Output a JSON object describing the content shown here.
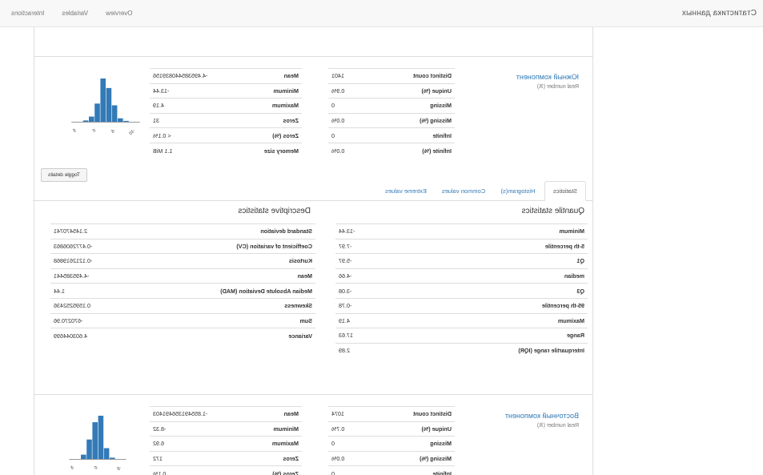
{
  "navbar": {
    "brand": "Статистика данных",
    "links": [
      "Overview",
      "Variables",
      "Interactions"
    ]
  },
  "variables": [
    {
      "name": "Южный компонент",
      "type": "Real number (ℝ)",
      "stats_left": [
        {
          "label": "Distinct count",
          "value": "1401"
        },
        {
          "label": "Unique (%)",
          "value": "0.9%"
        },
        {
          "label": "Missing",
          "value": "0"
        },
        {
          "label": "Missing (%)",
          "value": "0.0%"
        },
        {
          "label": "Infinite",
          "value": "0"
        },
        {
          "label": "Infinite (%)",
          "value": "0.0%"
        }
      ],
      "stats_right": [
        {
          "label": "Mean",
          "value": "-4.495385440839156"
        },
        {
          "label": "Minimum",
          "value": "-13.44"
        },
        {
          "label": "Maximum",
          "value": "4.19"
        },
        {
          "label": "Zeros",
          "value": "31"
        },
        {
          "label": "Zeros (%)",
          "value": "< 0.1%"
        },
        {
          "label": "Memory size",
          "value": "1.1 MiB"
        }
      ],
      "histogram": {
        "ticks": [
          "-10",
          "-5",
          "0",
          "5"
        ],
        "bars": [
          0.02,
          0.08,
          0.38,
          0.78,
          1.0,
          0.42,
          0.12,
          0.03
        ]
      },
      "toggle_label": "Toggle details",
      "tabs": [
        "Statistics",
        "Histogram(s)",
        "Common values",
        "Extreme values"
      ],
      "quantile": {
        "title": "Quantile statistics",
        "rows": [
          {
            "label": "Minimum",
            "value": "-13.44"
          },
          {
            "label": "5-th percentile",
            "value": "-7.97"
          },
          {
            "label": "Q1",
            "value": "-5.97"
          },
          {
            "label": "median",
            "value": "-4.66"
          },
          {
            "label": "Q3",
            "value": "-3.08"
          },
          {
            "label": "95-th percentile",
            "value": "-0.78"
          },
          {
            "label": "Maximum",
            "value": "4.19"
          },
          {
            "label": "Range",
            "value": "17.63"
          },
          {
            "label": "Interquartile range (IQR)",
            "value": "2.89"
          }
        ]
      },
      "descriptive": {
        "title": "Descriptive statistics",
        "rows": [
          {
            "label": "Standard deviation",
            "value": "2.145470741"
          },
          {
            "label": "Coefficient of variation (CV)",
            "value": "-0.4772606863"
          },
          {
            "label": "Kurtosis",
            "value": "-0.1212619868"
          },
          {
            "label": "Mean",
            "value": "-4.495385441"
          },
          {
            "label": "Median Absolute Deviation (MAD)",
            "value": "1.44"
          },
          {
            "label": "Skewness",
            "value": "0.1595252436"
          },
          {
            "label": "Sum",
            "value": "-670270.96"
          },
          {
            "label": "Variance",
            "value": "4.603044699"
          }
        ]
      }
    },
    {
      "name": "Восточный компонент",
      "type": "Real number (ℝ)",
      "stats_left": [
        {
          "label": "Distinct count",
          "value": "1074"
        },
        {
          "label": "Unique (%)",
          "value": "0.7%"
        },
        {
          "label": "Missing",
          "value": "0"
        },
        {
          "label": "Missing (%)",
          "value": "0.0%"
        },
        {
          "label": "Infinite",
          "value": "0"
        }
      ],
      "stats_right": [
        {
          "label": "Mean",
          "value": "-1.855491356491403"
        },
        {
          "label": "Minimum",
          "value": "-8.32"
        },
        {
          "label": "Maximum",
          "value": "6.92"
        },
        {
          "label": "Zeros",
          "value": "172"
        },
        {
          "label": "Zeros (%)",
          "value": "0.1%"
        }
      ],
      "histogram": {
        "ticks": [
          "-5",
          "0",
          "5"
        ],
        "bars": [
          0.03,
          0.25,
          1.0,
          0.85,
          0.45,
          0.1
        ]
      }
    }
  ]
}
